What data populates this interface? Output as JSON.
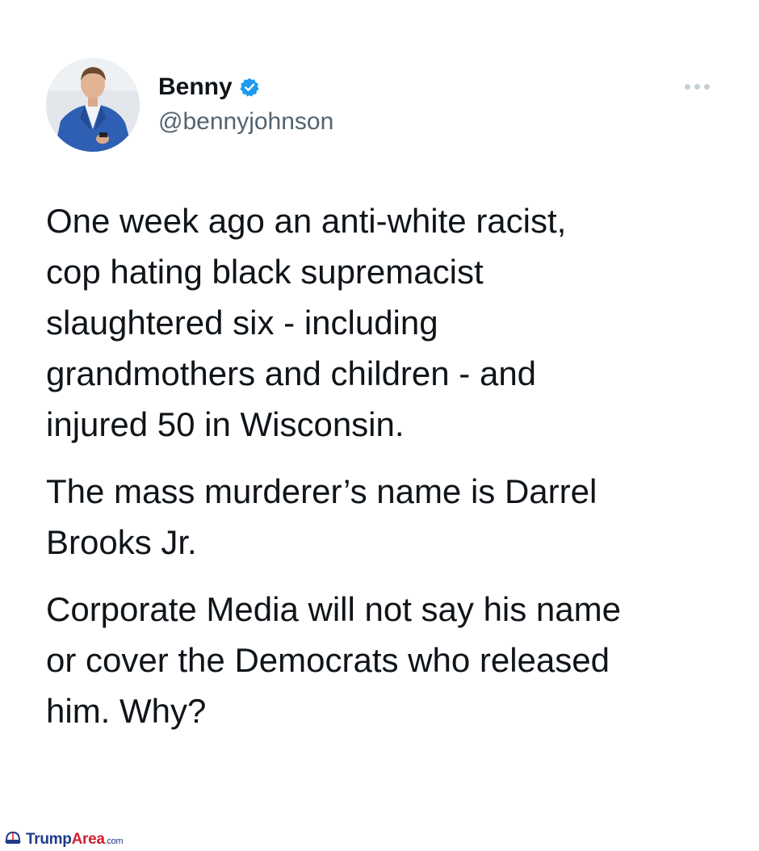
{
  "tweet": {
    "display_name": "Benny",
    "handle": "@bennyjohnson",
    "verified_icon": "verified-badge-icon",
    "more_icon": "more-options-icon",
    "paragraphs": [
      {
        "lines": [
          "One week ago an anti-white racist,",
          "cop hating black supremacist",
          "slaughtered six - including",
          "grandmothers and children - and",
          "injured 50 in Wisconsin."
        ]
      },
      {
        "lines": [
          "The mass murderer’s name is Darrel",
          "Brooks Jr."
        ]
      },
      {
        "lines": [
          "Corporate Media will not say his name",
          "or cover the Democrats who released",
          "him. Why?"
        ]
      }
    ]
  },
  "watermark": {
    "part1": "Trump",
    "part2": "Area",
    "part3": ".com",
    "icon": "hat-logo-icon"
  },
  "colors": {
    "text": "#0f1419",
    "secondary_text": "#536471",
    "verified_blue": "#1d9bf0",
    "more_dots": "#c4cfd6",
    "watermark_blue": "#1f3c8a",
    "watermark_red": "#d0202e"
  }
}
